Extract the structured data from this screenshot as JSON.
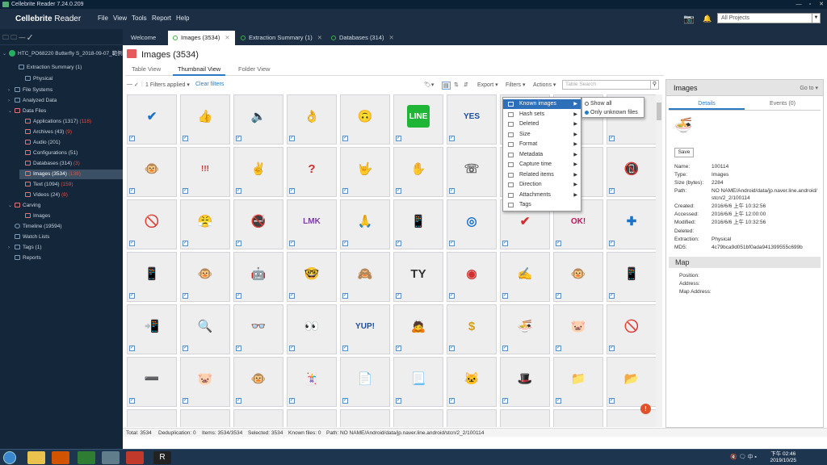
{
  "titlebar": {
    "title": "Cellebrite Reader 7.24.0.209"
  },
  "appbar": {
    "brand_a": "Cellebrite",
    "brand_b": " Reader",
    "menus": [
      "File",
      "View",
      "Tools",
      "Report",
      "Help"
    ],
    "project_select": "All Projects"
  },
  "sidebar": {
    "device": "HTC_PO68220 Butterfly S_2018-09-07_範例",
    "items": [
      {
        "label": "Extraction Summary (1)",
        "count": ""
      },
      {
        "label": "Physical",
        "count": ""
      },
      {
        "label": "File Systems",
        "count": ""
      },
      {
        "label": "Analyzed Data",
        "count": ""
      },
      {
        "label": "Data Files",
        "count": ""
      },
      {
        "label": "Applications (1317)",
        "count": "(118)"
      },
      {
        "label": "Archives (43)",
        "count": "(9)"
      },
      {
        "label": "Audio (201)",
        "count": ""
      },
      {
        "label": "Configurations (51)",
        "count": ""
      },
      {
        "label": "Databases (314)",
        "count": "(3)"
      },
      {
        "label": "Images (3534)",
        "count": "(138)"
      },
      {
        "label": "Text (1094)",
        "count": "(159)"
      },
      {
        "label": "Videos (24)",
        "count": "(8)"
      },
      {
        "label": "Carving",
        "count": ""
      },
      {
        "label": "Images",
        "count": ""
      },
      {
        "label": "Timeline (19594)",
        "count": ""
      },
      {
        "label": "Watch Lists",
        "count": ""
      },
      {
        "label": "Tags (1)",
        "count": ""
      },
      {
        "label": "Reports",
        "count": ""
      }
    ]
  },
  "tabs": [
    {
      "label": "Welcome"
    },
    {
      "label": "Images (3534)"
    },
    {
      "label": "Extraction Summary (1)"
    },
    {
      "label": "Databases (314)"
    }
  ],
  "page": {
    "title": "Images (3534)"
  },
  "view_tabs": [
    "Table View",
    "Thumbnail View",
    "Folder View"
  ],
  "toolbar": {
    "filters_applied": "1 Filters applied",
    "clear_filters": "Clear filters",
    "export": "Export",
    "filters": "Filters",
    "actions": "Actions",
    "search_placeholder": "Table Search"
  },
  "filters_menu": [
    "Known images",
    "Hash sets",
    "Deleted",
    "Size",
    "Format",
    "Metadata",
    "Capture time",
    "Related items",
    "Direction",
    "Attachments",
    "Tags"
  ],
  "known_submenu": [
    "Show all",
    "Only unknown files"
  ],
  "thumbnails": [
    {
      "g": "✔",
      "c": "#1a73c9",
      "b": ""
    },
    {
      "g": "👍",
      "c": "#d4a373",
      "b": ""
    },
    {
      "g": "🔈",
      "c": "#2b6cb0",
      "b": ""
    },
    {
      "g": "👌",
      "c": "#d4a373",
      "b": ""
    },
    {
      "g": "🙃",
      "c": "#222",
      "b": ""
    },
    {
      "g": "LINE",
      "c": "#fff",
      "b": "#1fb536"
    },
    {
      "g": "YES",
      "c": "#1a4fa0",
      "b": ""
    },
    {
      "g": "",
      "c": "#333",
      "b": ""
    },
    {
      "g": "",
      "c": "#333",
      "b": ""
    },
    {
      "g": "",
      "c": "#333",
      "b": ""
    },
    {
      "g": "🐵",
      "c": "#a0522d",
      "b": ""
    },
    {
      "g": "!!!",
      "c": "#c0392b",
      "b": ""
    },
    {
      "g": "✌",
      "c": "#d4a373",
      "b": ""
    },
    {
      "g": "?",
      "c": "#d32f2f",
      "b": ""
    },
    {
      "g": "🤟",
      "c": "#d4a373",
      "b": ""
    },
    {
      "g": "✋",
      "c": "#d4a373",
      "b": ""
    },
    {
      "g": "☏",
      "c": "#666",
      "b": ""
    },
    {
      "g": "",
      "c": "#333",
      "b": ""
    },
    {
      "g": "",
      "c": "#333",
      "b": ""
    },
    {
      "g": "📵",
      "c": "#d32f2f",
      "b": ""
    },
    {
      "g": "🚫",
      "c": "#d32f2f",
      "b": ""
    },
    {
      "g": "😤",
      "c": "#333",
      "b": ""
    },
    {
      "g": "🚭",
      "c": "#d32f2f",
      "b": ""
    },
    {
      "g": "LMK",
      "c": "#7b3fa0",
      "b": ""
    },
    {
      "g": "🙏",
      "c": "#d4a373",
      "b": ""
    },
    {
      "g": "📱",
      "c": "#2b6cb0",
      "b": ""
    },
    {
      "g": "◎",
      "c": "#1a73c9",
      "b": ""
    },
    {
      "g": "✔",
      "c": "#d32f2f",
      "b": ""
    },
    {
      "g": "OK!",
      "c": "#c2185b",
      "b": ""
    },
    {
      "g": "✚",
      "c": "#1a73c9",
      "b": ""
    },
    {
      "g": "📱",
      "c": "#2b6cb0",
      "b": ""
    },
    {
      "g": "🐵",
      "c": "#8d6e63",
      "b": ""
    },
    {
      "g": "🤖",
      "c": "#666",
      "b": ""
    },
    {
      "g": "🤓",
      "c": "#333",
      "b": ""
    },
    {
      "g": "🙈",
      "c": "#2e7d32",
      "b": ""
    },
    {
      "g": "TY",
      "c": "#333",
      "b": ""
    },
    {
      "g": "◉",
      "c": "#d32f2f",
      "b": ""
    },
    {
      "g": "✍",
      "c": "#555",
      "b": ""
    },
    {
      "g": "🐵",
      "c": "#8d6e63",
      "b": ""
    },
    {
      "g": "📱",
      "c": "#1a73c9",
      "b": ""
    },
    {
      "g": "📲",
      "c": "#1a73c9",
      "b": ""
    },
    {
      "g": "🔍",
      "c": "#8d6e63",
      "b": ""
    },
    {
      "g": "👓",
      "c": "#555",
      "b": ""
    },
    {
      "g": "👀",
      "c": "#222",
      "b": ""
    },
    {
      "g": "YUP!",
      "c": "#1a4fa0",
      "b": ""
    },
    {
      "g": "🙇",
      "c": "#8d6e63",
      "b": ""
    },
    {
      "g": "$",
      "c": "#d4a017",
      "b": ""
    },
    {
      "g": "🍜",
      "c": "#c62828",
      "b": ""
    },
    {
      "g": "🐷",
      "c": "#d4786f",
      "b": ""
    },
    {
      "g": "🚫",
      "c": "#d32f2f",
      "b": ""
    },
    {
      "g": "➖",
      "c": "#c62828",
      "b": ""
    },
    {
      "g": "🐷",
      "c": "#e91e63",
      "b": ""
    },
    {
      "g": "🐵",
      "c": "#8d6e63",
      "b": ""
    },
    {
      "g": "🃏",
      "c": "#d32f2f",
      "b": ""
    },
    {
      "g": "📄",
      "c": "#555",
      "b": ""
    },
    {
      "g": "📃",
      "c": "#555",
      "b": ""
    },
    {
      "g": "🐱",
      "c": "#e0a070",
      "b": ""
    },
    {
      "g": "🎩",
      "c": "#333",
      "b": ""
    },
    {
      "g": "📁",
      "c": "#f0b400",
      "b": ""
    },
    {
      "g": "📂",
      "c": "#f0b400",
      "b": ""
    }
  ],
  "details_tabs": [
    "Details",
    "Events (0)"
  ],
  "details": {
    "title": "Images",
    "goto": "Go to",
    "save": "Save",
    "props": [
      {
        "k": "Name:",
        "v": "100114"
      },
      {
        "k": "Type:",
        "v": "Images"
      },
      {
        "k": "Size (bytes):",
        "v": "2284"
      },
      {
        "k": "Path:",
        "v": "NO NAME/Android/data/jp.naver.line.android/"
      },
      {
        "k": "",
        "v": "stcn/2_2/100114"
      },
      {
        "k": "Created:",
        "v": "2016/6/6 上午 10:32:56"
      },
      {
        "k": "Accessed:",
        "v": "2016/6/6 上午 12:00:00"
      },
      {
        "k": "Modified:",
        "v": "2016/6/6 上午 10:32:56"
      },
      {
        "k": "Deleted:",
        "v": ""
      },
      {
        "k": "Extraction:",
        "v": "Physical"
      },
      {
        "k": "MD5:",
        "v": "4c79bca9d051bf0ada941399555c699b"
      }
    ],
    "map_title": "Map",
    "map_rows": [
      "Position:",
      "Address:",
      "Map Address:"
    ]
  },
  "status": {
    "total": "Total: 3534",
    "dedup": "Deduplication: 0",
    "items": "Items: 3534/3534",
    "selected": "Selected: 3534",
    "known": "Known files: 0",
    "path": "Path: NO NAME/Android/data/jp.naver.line.android/stcn/2_2/100114"
  },
  "taskbar": {
    "time": "下午 02:46",
    "date": "2019/10/25",
    "tray": "🔇 🗨 中 ▪"
  }
}
